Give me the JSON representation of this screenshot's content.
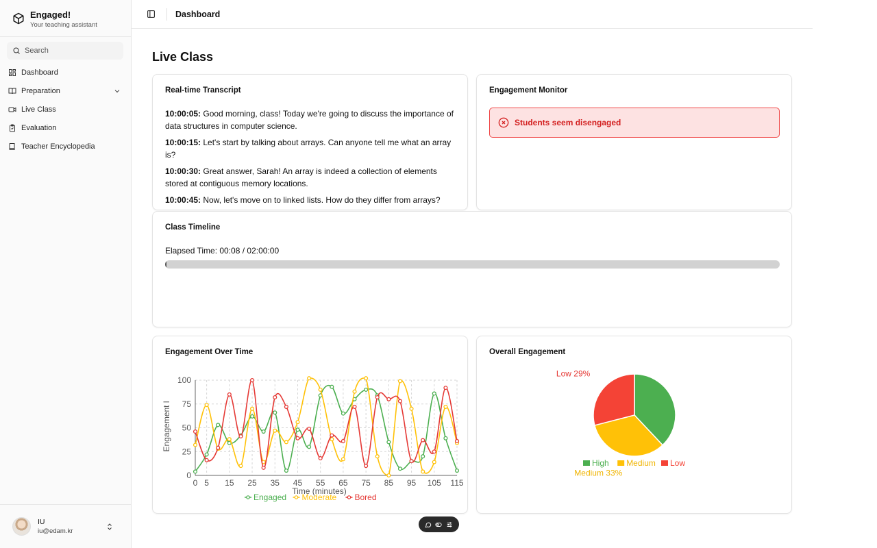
{
  "app": {
    "name": "Engaged!",
    "tagline": "Your teaching assistant"
  },
  "search": {
    "placeholder": "Search"
  },
  "nav": [
    {
      "label": "Dashboard",
      "icon": "dashboard-icon"
    },
    {
      "label": "Preparation",
      "icon": "book-open-icon",
      "expandable": true
    },
    {
      "label": "Live Class",
      "icon": "video-icon"
    },
    {
      "label": "Evaluation",
      "icon": "clipboard-check-icon"
    },
    {
      "label": "Teacher Encyclopedia",
      "icon": "book-icon"
    }
  ],
  "user": {
    "name": "IU",
    "email": "iu@edam.kr"
  },
  "header": {
    "title": "Dashboard"
  },
  "page": {
    "title": "Live Class"
  },
  "transcript": {
    "title": "Real-time Transcript",
    "entries": [
      {
        "time": "10:00:05:",
        "text": " Good morning, class! Today we're going to discuss the importance of data structures in computer science."
      },
      {
        "time": "10:00:15:",
        "text": " Let's start by talking about arrays. Can anyone tell me what an array is?"
      },
      {
        "time": "10:00:30:",
        "text": " Great answer, Sarah! An array is indeed a collection of elements stored at contiguous memory locations."
      },
      {
        "time": "10:00:45:",
        "text": " Now, let's move on to linked lists. How do they differ from arrays?"
      }
    ]
  },
  "monitor": {
    "title": "Engagement Monitor",
    "alert": "Students seem disengaged",
    "alert_color": "#d32020"
  },
  "timeline": {
    "title": "Class Timeline",
    "elapsed_label": "Elapsed Time: 00:08 / 02:00:00",
    "progress_fraction": 0.0011
  },
  "over_time": {
    "title": "Engagement Over Time"
  },
  "overall": {
    "title": "Overall Engagement"
  },
  "chart_data": [
    {
      "type": "line",
      "xlabel": "Time (minutes)",
      "ylabel": "Engagement l",
      "xlim": [
        0,
        115
      ],
      "ylim": [
        0,
        100
      ],
      "x_ticks": [
        0,
        5,
        15,
        25,
        35,
        45,
        55,
        65,
        75,
        85,
        95,
        105,
        115
      ],
      "y_ticks": [
        0,
        25,
        50,
        75,
        100
      ],
      "grid": true,
      "legend": "bottom",
      "x": [
        0,
        5,
        10,
        15,
        20,
        25,
        30,
        35,
        40,
        45,
        50,
        55,
        60,
        65,
        70,
        75,
        80,
        85,
        90,
        95,
        100,
        105,
        110,
        115
      ],
      "series": [
        {
          "name": "Engaged",
          "color": "#4caf50",
          "values": [
            4,
            22,
            53,
            34,
            42,
            62,
            46,
            66,
            5,
            48,
            30,
            84,
            93,
            65,
            80,
            90,
            84,
            35,
            7,
            15,
            20,
            86,
            39,
            5
          ]
        },
        {
          "name": "Moderate",
          "color": "#ffc107",
          "values": [
            32,
            74,
            28,
            38,
            10,
            70,
            14,
            47,
            35,
            56,
            102,
            90,
            38,
            17,
            88,
            102,
            20,
            0,
            99,
            70,
            4,
            14,
            72,
            34
          ]
        },
        {
          "name": "Bored",
          "color": "#e53935",
          "values": [
            46,
            16,
            29,
            85,
            41,
            100,
            8,
            82,
            72,
            39,
            49,
            18,
            42,
            36,
            72,
            10,
            82,
            80,
            78,
            15,
            37,
            25,
            92,
            36
          ]
        }
      ]
    },
    {
      "type": "pie",
      "categories": [
        "High",
        "Medium",
        "Low"
      ],
      "values": [
        38,
        33,
        29
      ],
      "colors": [
        "#4caf50",
        "#ffc107",
        "#f44336"
      ],
      "data_labels": [
        "",
        "Medium 33%",
        "Low 29%"
      ],
      "legend": "bottom"
    }
  ]
}
